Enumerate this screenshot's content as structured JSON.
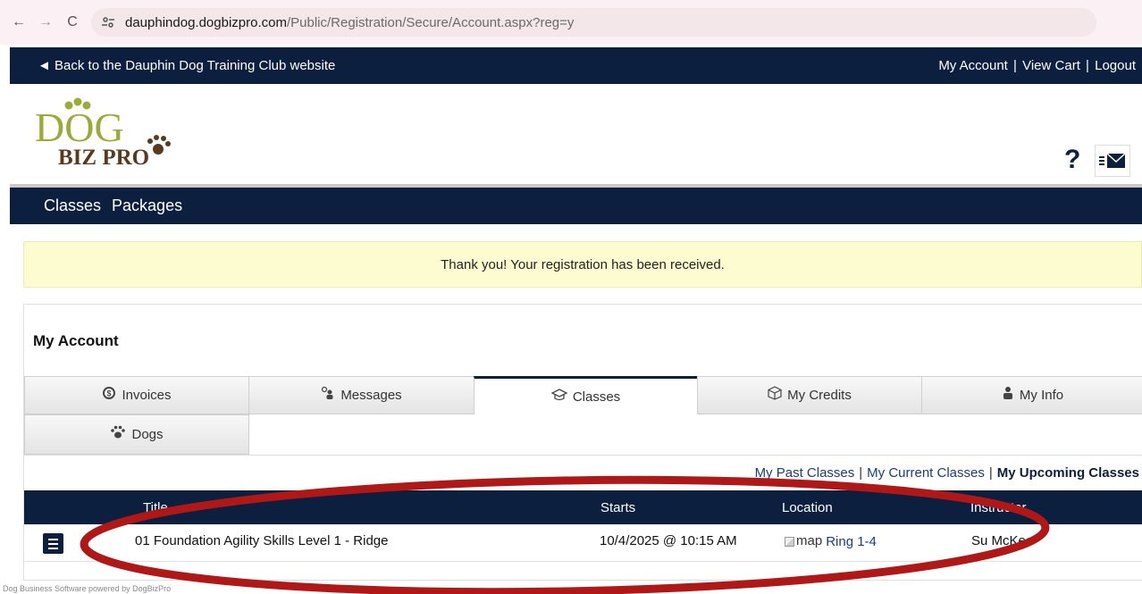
{
  "browser": {
    "url_host": "dauphindog.dogbizpro.com",
    "url_path": "/Public/Registration/Secure/Account.aspx?reg=y"
  },
  "topbar": {
    "back_link": "◄ Back to the Dauphin Dog Training Club website",
    "my_account": "My Account",
    "view_cart": "View Cart",
    "logout": "Logout",
    "separator": "|"
  },
  "logo": {
    "line1": "DOG",
    "line2": "BIZ PRO"
  },
  "header": {
    "help": "?"
  },
  "menu": {
    "items": [
      "Classes",
      "Packages"
    ]
  },
  "alert": {
    "message": "Thank you! Your registration has been received."
  },
  "account": {
    "title": "My Account",
    "tabs": [
      {
        "label": "Invoices",
        "icon": "dollar-icon"
      },
      {
        "label": "Messages",
        "icon": "person-icon"
      },
      {
        "label": "Classes",
        "icon": "graduation-cap-icon",
        "active": true
      },
      {
        "label": "My Credits",
        "icon": "box-icon"
      },
      {
        "label": "My Info",
        "icon": "person-icon"
      },
      {
        "label": "Dogs",
        "icon": "paw-icon"
      }
    ],
    "subnav": {
      "past": "My Past Classes",
      "current": "My Current Classes",
      "upcoming": "My Upcoming Classes",
      "separator": "|"
    },
    "table": {
      "headers": [
        "Title",
        "Starts",
        "Location",
        "Instructor"
      ],
      "rows": [
        {
          "title": "01 Foundation Agility Skills Level 1 - Ridge",
          "starts": "10/4/2025 @ 10:15 AM",
          "map_alt": "map",
          "location": "Ring 1-4",
          "instructor": "Su McKee"
        }
      ]
    }
  },
  "footer": {
    "note": "Dog Business Software powered by DogBizPro"
  },
  "colors": {
    "navy": "#0c1f3f",
    "alert_bg": "#fdfcd1",
    "annotation": "#b01818",
    "logo_green": "#9aab3c",
    "logo_brown": "#5a3a1e"
  }
}
